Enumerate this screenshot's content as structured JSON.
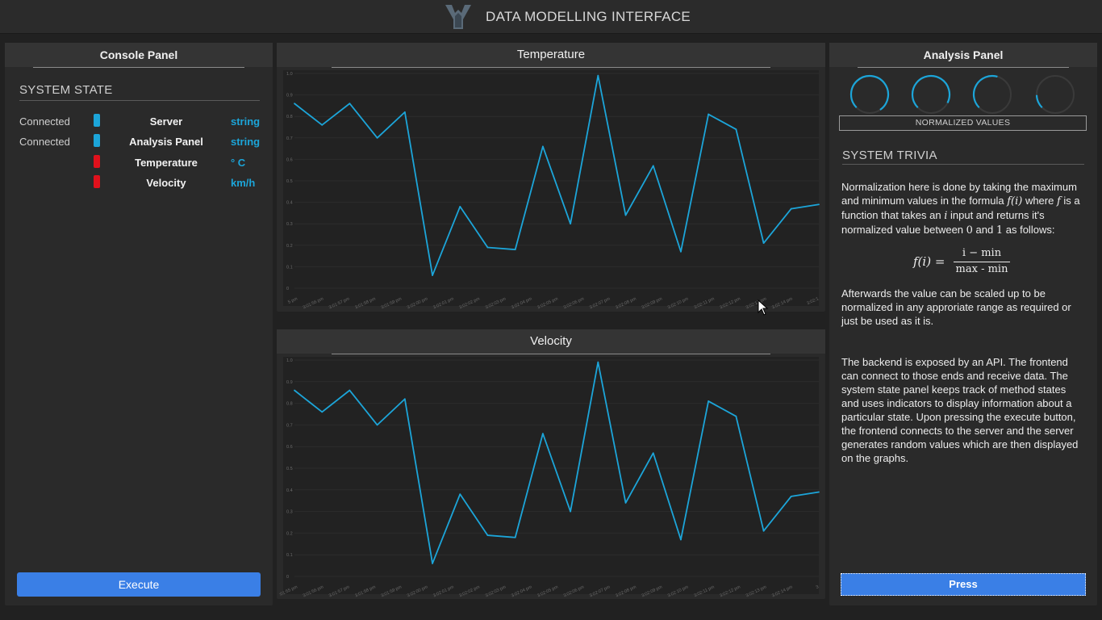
{
  "app": {
    "title": "DATA MODELLING INTERFACE"
  },
  "console": {
    "title": "Console Panel",
    "section_title": "SYSTEM STATE",
    "rows": [
      {
        "status": "Connected",
        "indicator_color": "#1ca5d9",
        "name": "Server",
        "unit": "string"
      },
      {
        "status": "Connected",
        "indicator_color": "#1ca5d9",
        "name": "Analysis Panel",
        "unit": "string"
      },
      {
        "status": "",
        "indicator_color": "#e0111c",
        "name": "Temperature",
        "unit": "° C"
      },
      {
        "status": "",
        "indicator_color": "#e0111c",
        "name": "Velocity",
        "unit": "km/h"
      }
    ],
    "execute_label": "Execute"
  },
  "temperature": {
    "title": "Temperature"
  },
  "velocity": {
    "title": "Velocity"
  },
  "chart_data": [
    {
      "type": "line",
      "title": "Temperature",
      "ylim": [
        0,
        1.0
      ],
      "yticks": [
        "0",
        "0.1",
        "0.2",
        "0.3",
        "0.4",
        "0.5",
        "0.6",
        "0.7",
        "0.8",
        "0.9",
        "1.0"
      ],
      "x": [
        "5 pm",
        "3:01:56 pm",
        "3:01:57 pm",
        "3:01:58 pm",
        "3:01:59 pm",
        "3:02:00 pm",
        "3:02:01 pm",
        "3:02:02 pm",
        "3:02:03 pm",
        "3:02:04 pm",
        "3:02:05 pm",
        "3:02:06 pm",
        "3:02:07 pm",
        "3:02:08 pm",
        "3:02:09 pm",
        "3:02:10 pm",
        "3:02:11 pm",
        "3:02:12 pm",
        "3:02:13 pm",
        "3:02:14 pm",
        "3:02:1"
      ],
      "series": [
        {
          "color": "#1ca5d9",
          "values": [
            0.86,
            0.76,
            0.86,
            0.7,
            0.82,
            0.06,
            0.38,
            0.19,
            0.18,
            0.66,
            0.3,
            0.99,
            0.34,
            0.57,
            0.17,
            0.81,
            0.74,
            0.21,
            0.37,
            0.39
          ]
        }
      ]
    },
    {
      "type": "line",
      "title": "Velocity",
      "ylim": [
        0,
        1.0
      ],
      "yticks": [
        "0",
        "0.1",
        "0.2",
        "0.3",
        "0.4",
        "0.5",
        "0.6",
        "0.7",
        "0.8",
        "0.9",
        "1.0"
      ],
      "x": [
        ":01:55 pm",
        "3:01:56 pm",
        "3:01:57 pm",
        "3:01:58 pm",
        "3:01:59 pm",
        "3:02:00 pm",
        "3:02:01 pm",
        "3:02:02 pm",
        "3:02:03 pm",
        "3:02:04 pm",
        "3:02:05 pm",
        "3:02:06 pm",
        "3:02:07 pm",
        "3:02:08 pm",
        "3:02:09 pm",
        "3:02:10 pm",
        "3:02:11 pm",
        "3:02:12 pm",
        "3:02:13 pm",
        "3:02:14 pm",
        "3"
      ],
      "series": [
        {
          "color": "#1ca5d9",
          "values": [
            0.86,
            0.76,
            0.86,
            0.7,
            0.82,
            0.06,
            0.38,
            0.19,
            0.18,
            0.66,
            0.3,
            0.99,
            0.34,
            0.57,
            0.17,
            0.81,
            0.74,
            0.21,
            0.37,
            0.39
          ]
        }
      ]
    }
  ],
  "analysis": {
    "title": "Analysis Panel",
    "gauges": [
      {
        "value": 0.78,
        "color": "#1ca5d9"
      },
      {
        "value": 0.7,
        "color": "#1ca5d9"
      },
      {
        "value": 0.42,
        "color": "#1ca5d9"
      },
      {
        "value": 0.12,
        "color": "#1ca5d9"
      }
    ],
    "normalized_label": "NORMALIZED VALUES",
    "trivia_title": "SYSTEM TRIVIA",
    "p1_a": "Normalization here is done by taking the maximum and minimum values in the formula ",
    "p1_fi": "f(i)",
    "p1_b": " where ",
    "p1_f": "f",
    "p1_c": " is a function that takes an ",
    "p1_i": "i",
    "p1_d": " input and returns it's normalized value between ",
    "p1_zero": "0",
    "p1_e": " and ",
    "p1_one": "1",
    "p1_f2": " as follows:",
    "formula_lhs": "f(i) =",
    "formula_num": "i − min",
    "formula_den": "max - min",
    "p2": "Afterwards the value can be scaled up to be normalized in any approriate range as required or just be used as it is.",
    "p3": "The backend is exposed by an API. The frontend can connect to those ends and receive data. The system state panel keeps track of method states and uses indicators to display information about a particular state. Upon pressing the execute button, the frontend connects to the server and the server generates random values which are then displayed on the graphs.",
    "press_label": "Press"
  }
}
